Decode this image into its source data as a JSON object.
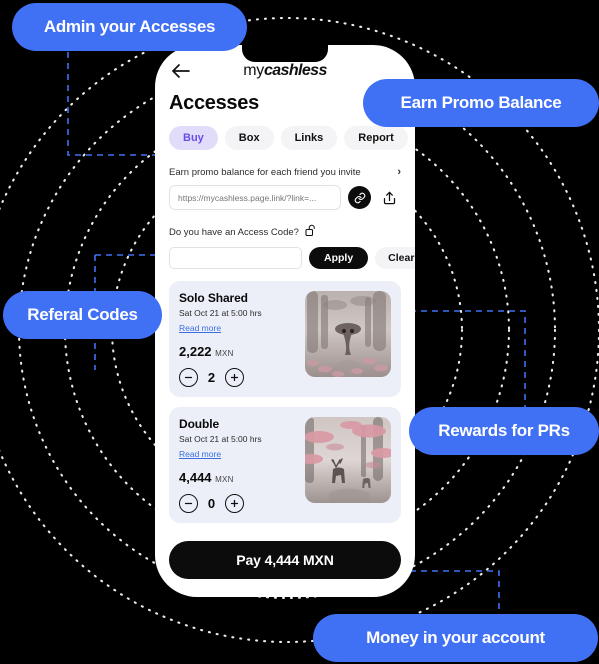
{
  "colors": {
    "accent_blue": "#4070f4",
    "page_bg": "#000000",
    "phone_bg": "#ffffff",
    "card_bg": "#eceff7",
    "active_tab_bg": "#e2dcfb",
    "active_tab_text": "#6a4de8",
    "dark_button": "#0c0c0c",
    "link_blue": "#3b6fe0"
  },
  "callouts": [
    {
      "id": "admin",
      "label": "Admin your Accesses"
    },
    {
      "id": "earn",
      "label": "Earn Promo Balance"
    },
    {
      "id": "referal",
      "label": "Referal Codes"
    },
    {
      "id": "rewards",
      "label": "Rewards for PRs"
    },
    {
      "id": "money",
      "label": "Money in your account"
    }
  ],
  "phone": {
    "topbar": {
      "back_icon": "arrow-left-icon",
      "brand_prefix": "my",
      "brand_suffix": "cashless"
    },
    "page_title": "Accesses",
    "tabs": [
      {
        "label": "Buy",
        "active": true
      },
      {
        "label": "Box",
        "active": false
      },
      {
        "label": "Links",
        "active": false
      },
      {
        "label": "Report",
        "active": false
      }
    ],
    "promo": {
      "text": "Earn promo balance for each friend you invite",
      "chevron": "›",
      "link_placeholder": "https://mycashless.page.link/?link=...",
      "link_value": "",
      "copy_icon": "link-chain-icon",
      "share_icon": "share-upload-icon"
    },
    "access_code": {
      "label": "Do you have an Access Code?",
      "lock_icon": "unlocked-padlock-icon",
      "input_value": "",
      "input_placeholder": "",
      "apply_label": "Apply",
      "clear_label": "Clear"
    },
    "products": [
      {
        "title": "Solo Shared",
        "date": "Sat Oct 21 at 5:00 hrs",
        "read_more": "Read more",
        "price": "2,222",
        "currency": "MXN",
        "quantity": "2",
        "image_alt": "mushroom-creature-forest-thumbnail"
      },
      {
        "title": "Double",
        "date": "Sat Oct 21 at 5:00 hrs",
        "read_more": "Read more",
        "price": "4,444",
        "currency": "MXN",
        "quantity": "0",
        "image_alt": "deer-mushroom-forest-thumbnail"
      }
    ],
    "pay_button": "Pay 4,444 MXN"
  }
}
